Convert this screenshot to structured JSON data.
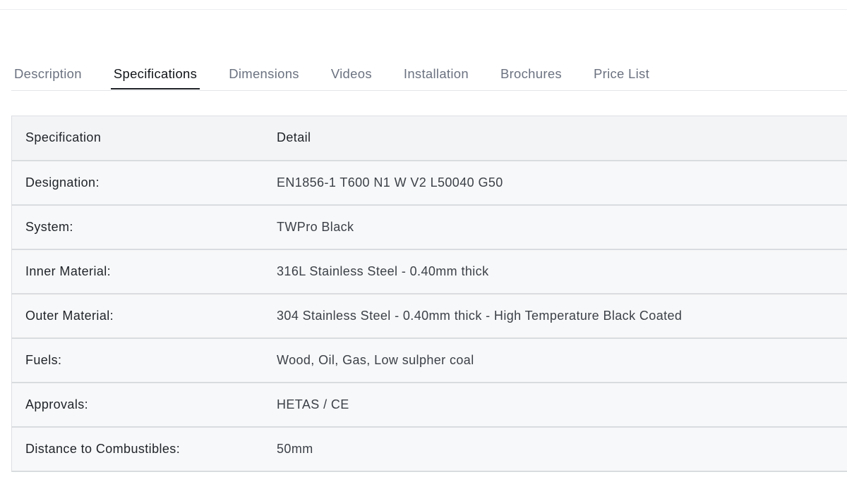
{
  "tabs": [
    {
      "label": "Description",
      "active": false
    },
    {
      "label": "Specifications",
      "active": true
    },
    {
      "label": "Dimensions",
      "active": false
    },
    {
      "label": "Videos",
      "active": false
    },
    {
      "label": "Installation",
      "active": false
    },
    {
      "label": "Brochures",
      "active": false
    },
    {
      "label": "Price List",
      "active": false
    }
  ],
  "table": {
    "headers": [
      "Specification",
      "Detail"
    ],
    "rows": [
      {
        "label": "Designation:",
        "value": "EN1856-1 T600 N1 W V2 L50040 G50"
      },
      {
        "label": "System:",
        "value": "TWPro Black"
      },
      {
        "label": "Inner Material:",
        "value": "316L Stainless Steel - 0.40mm thick"
      },
      {
        "label": "Outer Material:",
        "value": "304 Stainless Steel - 0.40mm thick - High Temperature Black Coated"
      },
      {
        "label": "Fuels:",
        "value": "Wood, Oil, Gas, Low sulpher coal"
      },
      {
        "label": "Approvals:",
        "value": "HETAS / CE"
      },
      {
        "label": "Distance to Combustibles:",
        "value": "50mm"
      }
    ]
  },
  "colors": {
    "active_tab": "#111418",
    "inactive_tab": "#6b7280",
    "table_border": "#d9dcdf",
    "header_bg": "#f3f4f6"
  }
}
